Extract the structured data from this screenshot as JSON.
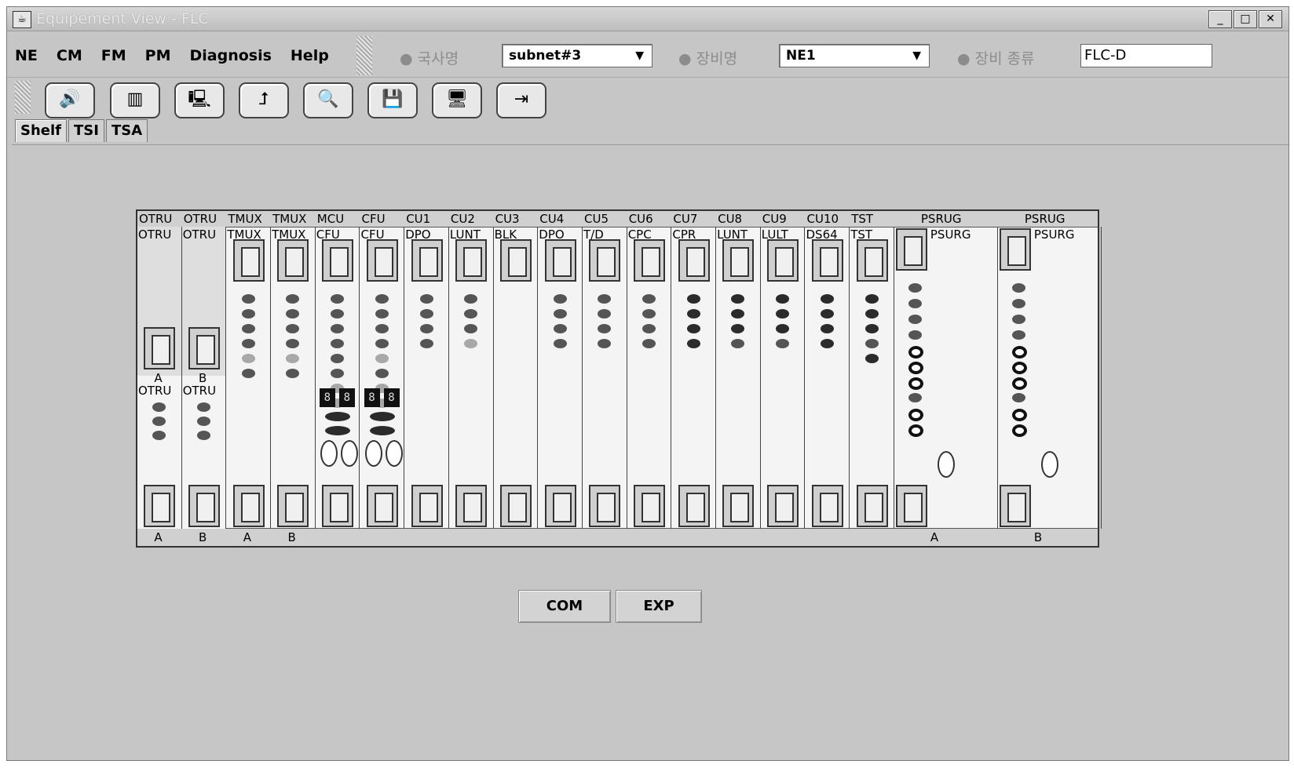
{
  "window": {
    "title": "Equipement View - FLC"
  },
  "menu": [
    "NE",
    "CM",
    "FM",
    "PM",
    "Diagnosis",
    "Help"
  ],
  "fields": {
    "office_label": "국사명",
    "office_value": "subnet#3",
    "equip_name_label": "장비명",
    "equip_name_value": "NE1",
    "equip_type_label": "장비 종류",
    "equip_type_value": "FLC-D"
  },
  "toolbar_icons": [
    "alarm-sound-icon",
    "shelf-view-icon",
    "equipment-search-icon",
    "signal-path-icon",
    "zoom-search-icon",
    "save-icon",
    "monitor-icon",
    "exit-icon"
  ],
  "tabs": [
    "Shelf",
    "TSI",
    "TSA"
  ],
  "shelf": {
    "top_labels": [
      "OTRU",
      "OTRU",
      "TMUX",
      "TMUX",
      "MCU",
      "CFU",
      "CU1",
      "CU2",
      "CU3",
      "CU4",
      "CU5",
      "CU6",
      "CU7",
      "CU8",
      "CU9",
      "CU10",
      "TST",
      "PSRUG",
      "PSRUG"
    ],
    "card_labels": [
      "OTRU",
      "OTRU",
      "TMUX",
      "TMUX",
      "CFU",
      "CFU",
      "DPO",
      "LUNT",
      "BLK",
      "DPO",
      "T/D",
      "CPC",
      "CPR",
      "LUNT",
      "LULT",
      "DS64",
      "TST",
      "PSURG",
      "PSURG"
    ],
    "sub_labels": [
      "A",
      "B"
    ],
    "sub_card_labels": [
      "OTRU",
      "OTRU"
    ],
    "bottom_labels": [
      "A",
      "B",
      "A",
      "B",
      "A",
      "B"
    ]
  },
  "buttons": {
    "com": "COM",
    "exp": "EXP"
  }
}
